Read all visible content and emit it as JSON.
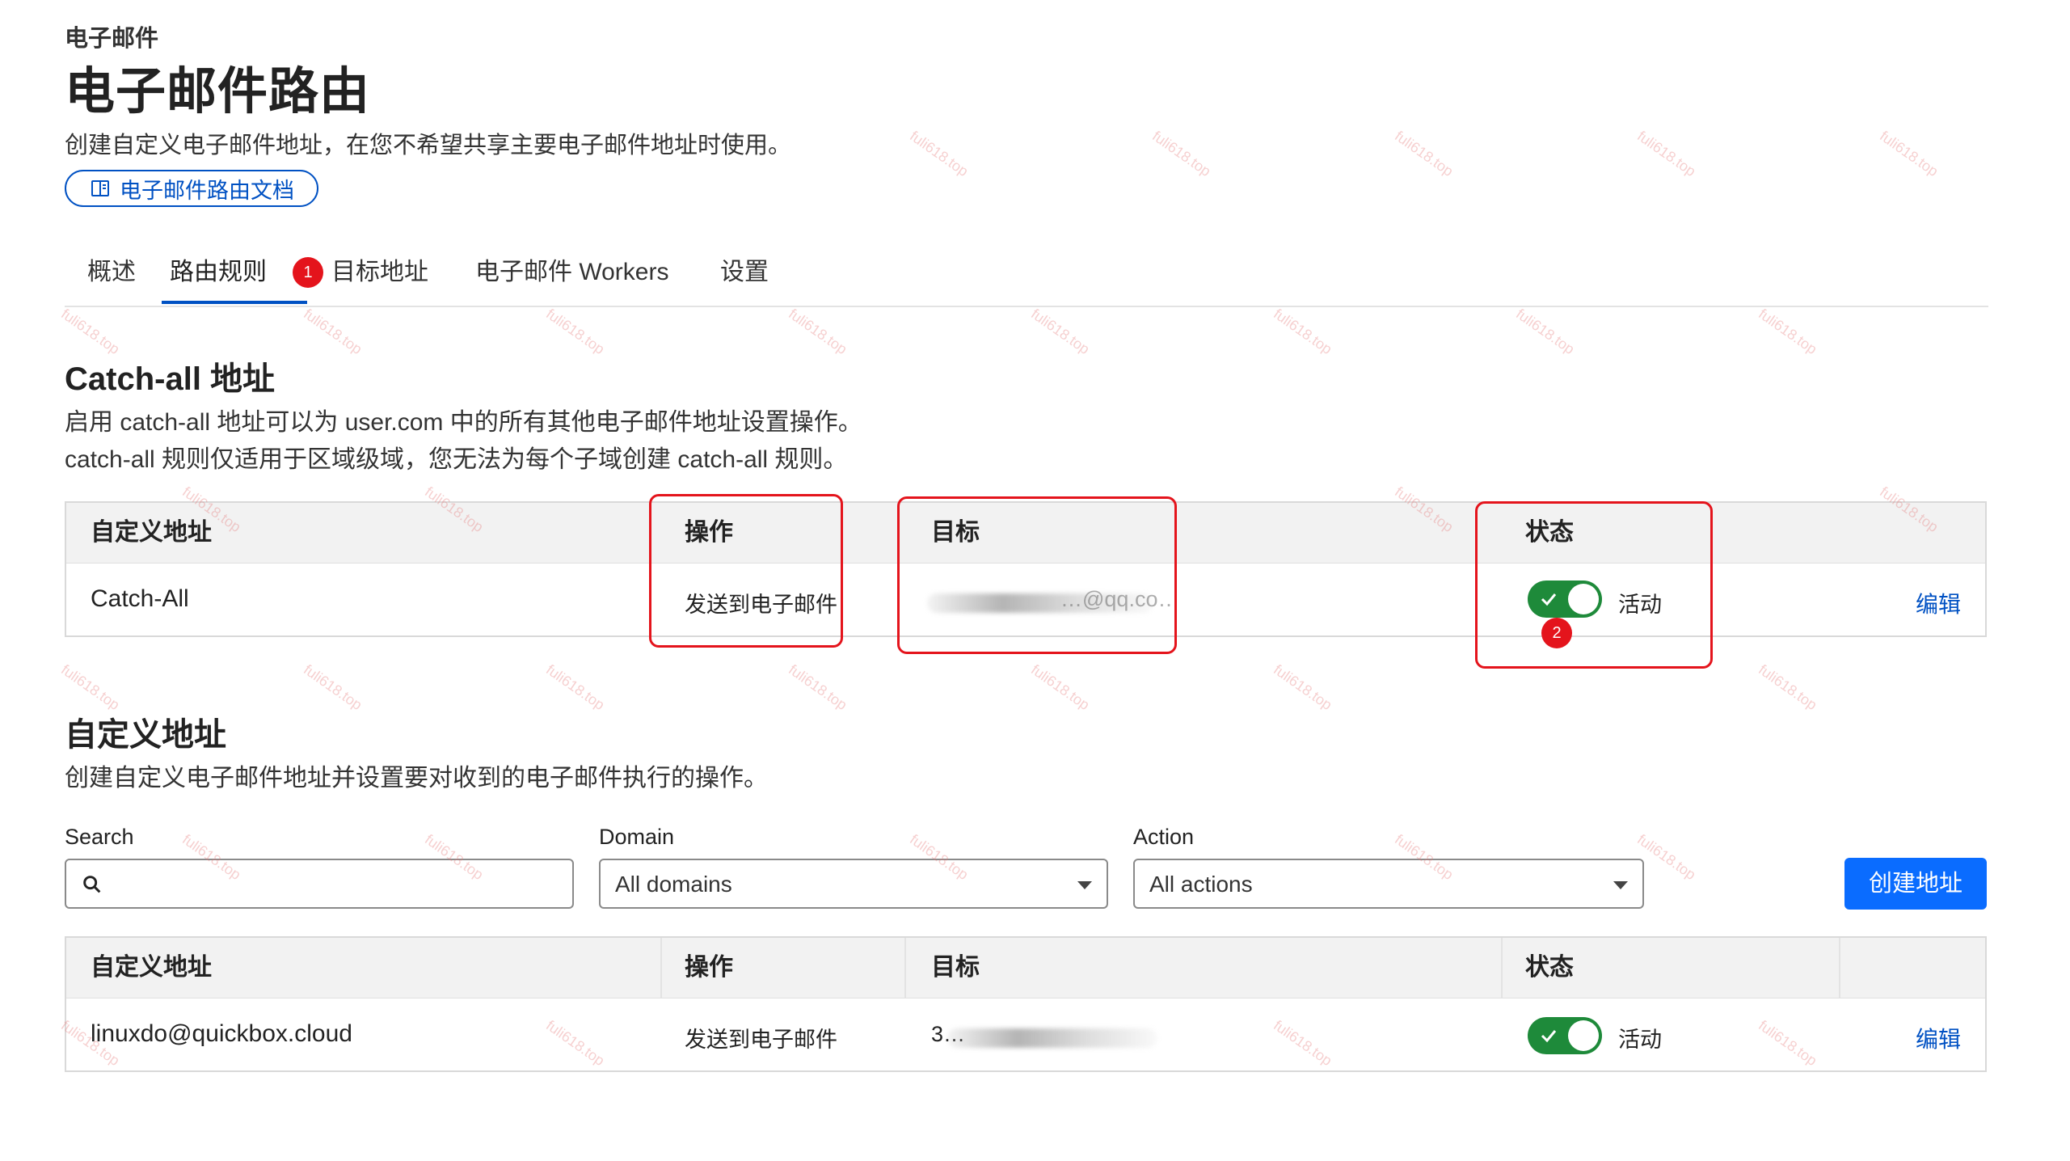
{
  "header": {
    "breadcrumb": "电子邮件",
    "title": "电子邮件路由",
    "description": "创建自定义电子邮件地址，在您不希望共享主要电子邮件地址时使用。",
    "doc_link": "电子邮件路由文档"
  },
  "tabs": [
    {
      "label": "概述",
      "active": false
    },
    {
      "label": "路由规则",
      "active": true
    },
    {
      "label": "目标地址",
      "active": false
    },
    {
      "label": "电子邮件 Workers",
      "active": false
    },
    {
      "label": "设置",
      "active": false
    }
  ],
  "annotations": {
    "badge1": "1",
    "badge2": "2"
  },
  "catch_all": {
    "heading": "Catch-all 地址",
    "desc_line1": "启用 catch-all 地址可以为 user.com 中的所有其他电子邮件地址设置操作。",
    "desc_line2": "catch-all 规则仅适用于区域级域，您无法为每个子域创建 catch-all 规则。",
    "columns": [
      "自定义地址",
      "操作",
      "目标",
      "状态"
    ],
    "row": {
      "address": "Catch-All",
      "action": "发送到电子邮件",
      "target": "…@qq.co…",
      "status": "活动",
      "edit": "编辑"
    }
  },
  "custom": {
    "heading": "自定义地址",
    "description": "创建自定义电子邮件地址并设置要对收到的电子邮件执行的操作。",
    "search_label": "Search",
    "search_value": "",
    "domain_label": "Domain",
    "domain_value": "All domains",
    "action_label": "Action",
    "action_value": "All actions",
    "create_button": "创建地址",
    "columns": [
      "自定义地址",
      "操作",
      "目标",
      "状态"
    ],
    "rows": [
      {
        "address": "linuxdo@quickbox.cloud",
        "action": "发送到电子邮件",
        "target": "3…",
        "status": "活动",
        "edit": "编辑"
      }
    ]
  },
  "watermark": "fuli618.top",
  "colors": {
    "accent": "#0051c3",
    "button": "#0a6cff",
    "toggle_on": "#1e8a3a",
    "annotation": "#e4141c"
  }
}
